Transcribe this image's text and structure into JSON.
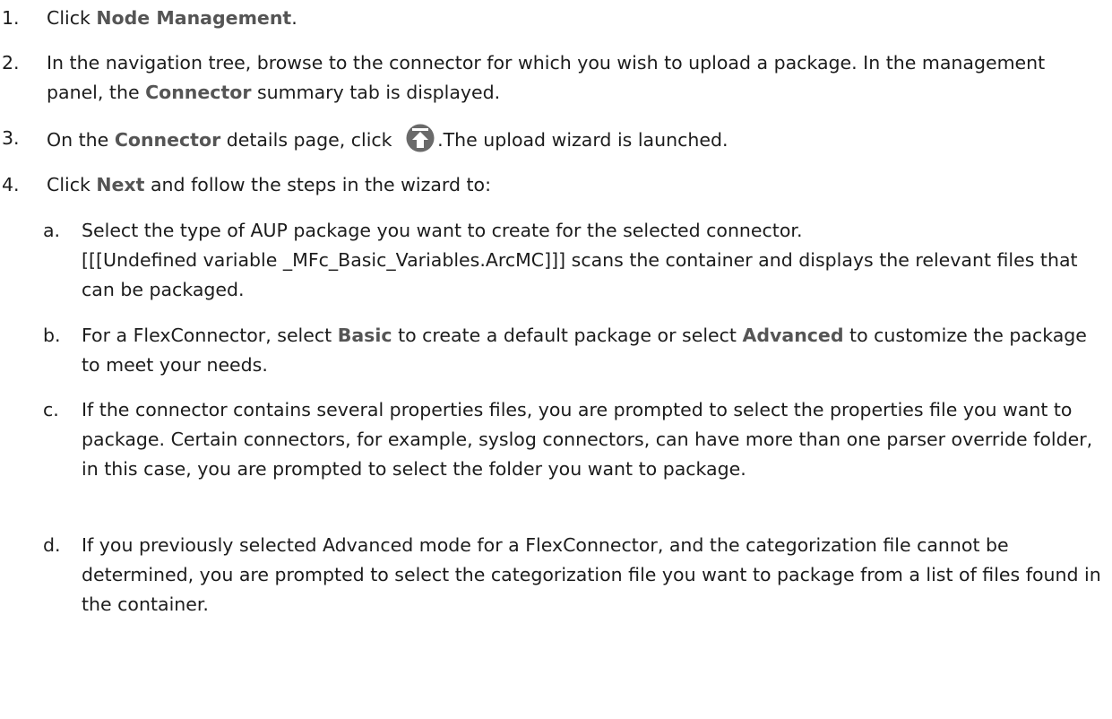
{
  "steps": [
    {
      "number": "1.",
      "parts": [
        "Click ",
        "Node Management",
        "."
      ]
    },
    {
      "number": "2.",
      "parts": [
        "In the navigation tree, browse to the connector for which you wish to upload a package. In the management panel, the ",
        "Connector",
        " summary tab is displayed."
      ]
    },
    {
      "number": "3.",
      "parts": [
        "On the ",
        "Connector",
        " details page, click ",
        ".The upload wizard is launched."
      ],
      "icon": "upload-icon"
    },
    {
      "number": "4.",
      "parts": [
        "Click ",
        "Next",
        " and follow the steps in the wizard to:"
      ],
      "substeps": [
        {
          "letter": "a.",
          "text_line1": "Select the type of AUP package you want to create for the selected connector.",
          "text_line2": "[[[Undefined variable _MFc_Basic_Variables.ArcMC]]] scans the container and displays the relevant files that can be packaged."
        },
        {
          "letter": "b.",
          "parts": [
            "For a FlexConnector, select ",
            "Basic",
            " to create a default package or select ",
            "Advanced",
            " to customize the package to meet your needs."
          ]
        },
        {
          "letter": "c.",
          "text": "If the connector contains several properties files, you are prompted to select the properties file you want to package. Certain connectors, for example, syslog connectors, can have more than one parser override folder, in this case, you are prompted to select the folder you want to package."
        },
        {
          "letter": "d.",
          "text": "If you previously selected Advanced mode for a FlexConnector, and the categorization file cannot be determined, you are prompted to select the categorization file you want to package from a list of files found in the container."
        }
      ]
    }
  ],
  "colors": {
    "text": "#1c1c1c",
    "highlight": "#555555",
    "icon": "#6a6a6a"
  }
}
